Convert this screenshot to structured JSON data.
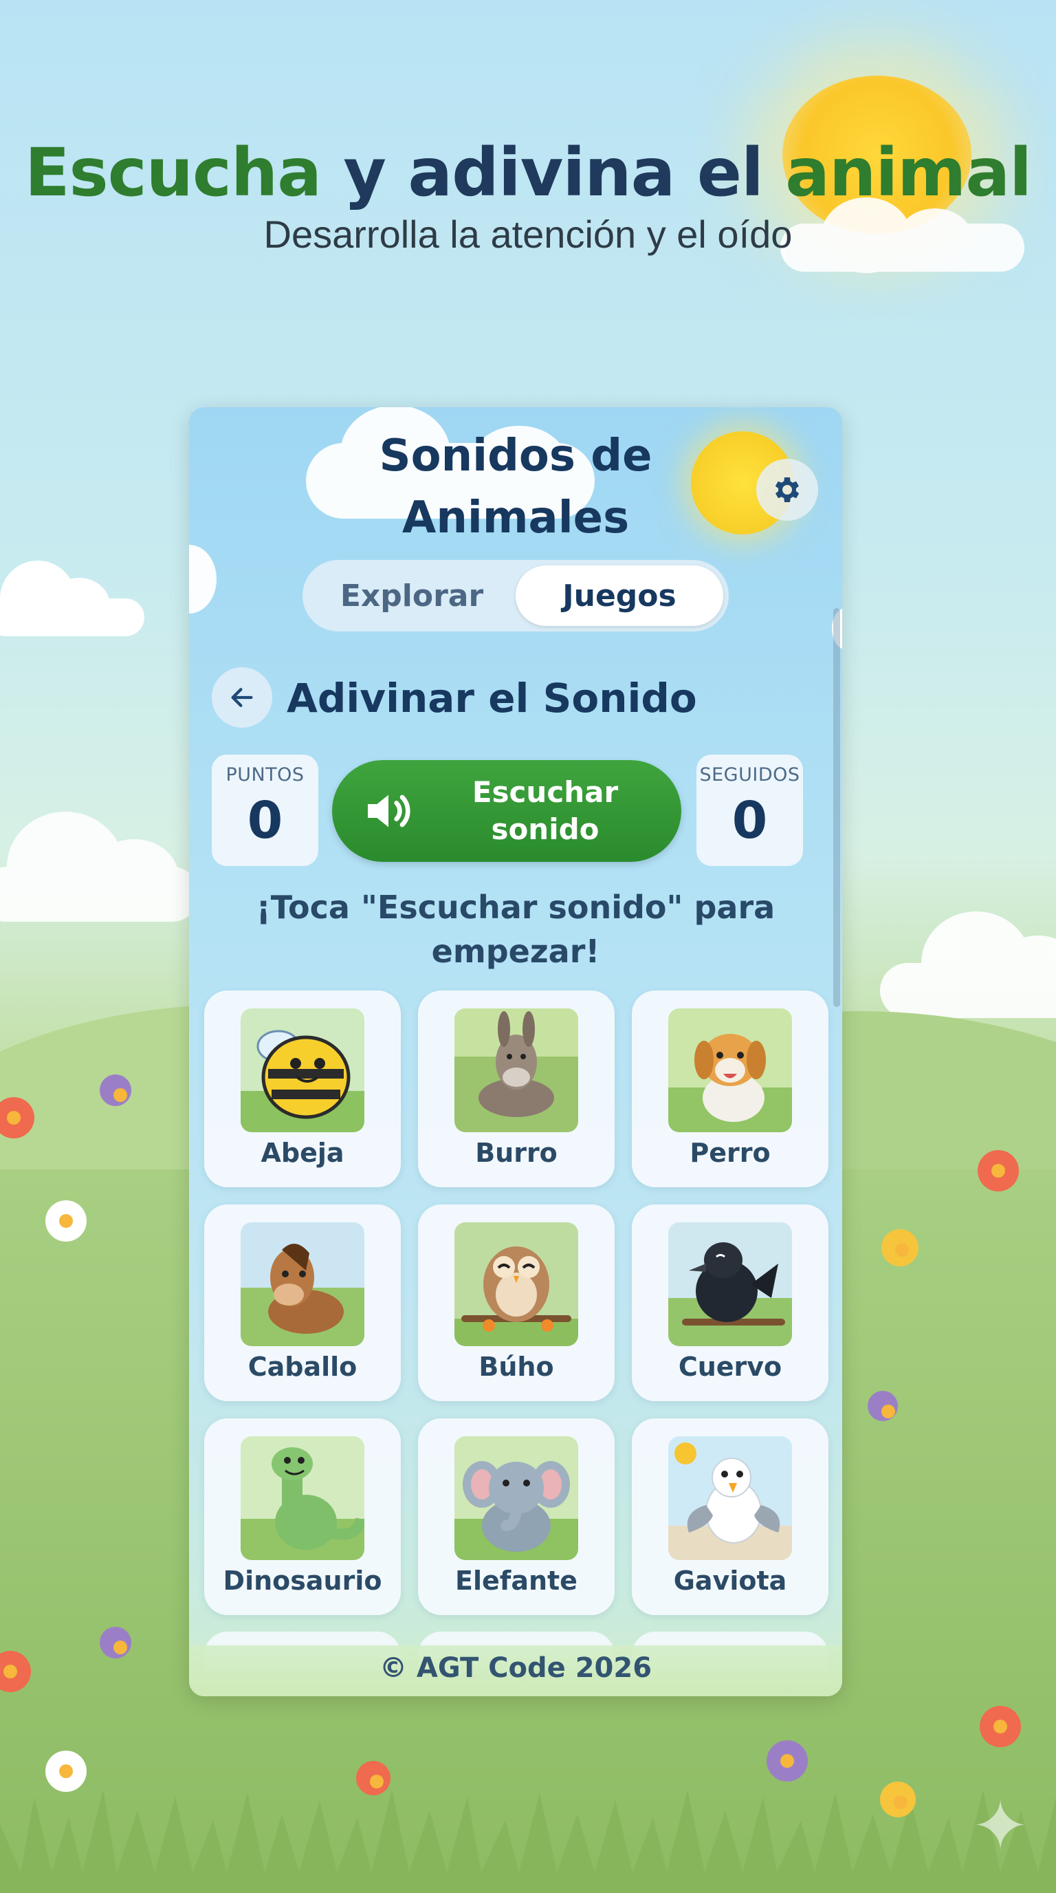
{
  "page": {
    "headline_part1": "Escucha",
    "headline_part2": " y adivina el ",
    "headline_part3": "animal",
    "subtitle": "Desarrolla la atención y el oído"
  },
  "app": {
    "title_line1": "Sonidos de",
    "title_line2": "Animales",
    "settings_icon": "gear-icon",
    "tabs": [
      {
        "label": "Explorar",
        "active": false
      },
      {
        "label": "Juegos",
        "active": true
      }
    ],
    "screen_title": "Adivinar el Sonido",
    "back_icon": "arrow-left-icon",
    "score": {
      "label": "PUNTOS",
      "value": "0"
    },
    "streak": {
      "label": "SEGUIDOS",
      "value": "0"
    },
    "listen_button": {
      "line1": "Escuchar",
      "line2": "sonido",
      "icon": "speaker-icon"
    },
    "instruction": "¡Toca \"Escuchar sonido\" para empezar!",
    "animals": [
      {
        "name": "Abeja"
      },
      {
        "name": "Burro"
      },
      {
        "name": "Perro"
      },
      {
        "name": "Caballo"
      },
      {
        "name": "Búho"
      },
      {
        "name": "Cuervo"
      },
      {
        "name": "Dinosaurio"
      },
      {
        "name": "Elefante"
      },
      {
        "name": "Gaviota"
      }
    ],
    "footer": "© AGT Code 2026"
  },
  "colors": {
    "title_navy": "#17385f",
    "accent_green": "#2f7d2e",
    "button_green": "#3fa43e"
  }
}
